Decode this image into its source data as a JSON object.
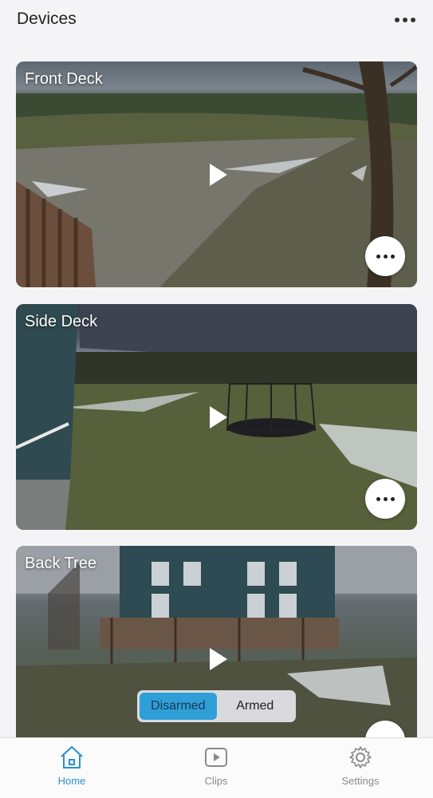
{
  "header": {
    "title": "Devices",
    "more_icon": "ellipsis-icon"
  },
  "cameras": [
    {
      "name": "Front Deck"
    },
    {
      "name": "Side Deck"
    },
    {
      "name": "Back Tree"
    }
  ],
  "arm_toggle": {
    "options": [
      "Disarmed",
      "Armed"
    ],
    "selected": "Disarmed"
  },
  "tabs": [
    {
      "label": "Home",
      "icon": "home-icon",
      "active": true
    },
    {
      "label": "Clips",
      "icon": "play-box-icon",
      "active": false
    },
    {
      "label": "Settings",
      "icon": "gear-icon",
      "active": false
    }
  ],
  "colors": {
    "accent": "#2b8fd1",
    "toggle_active": "#2f9fd8"
  }
}
